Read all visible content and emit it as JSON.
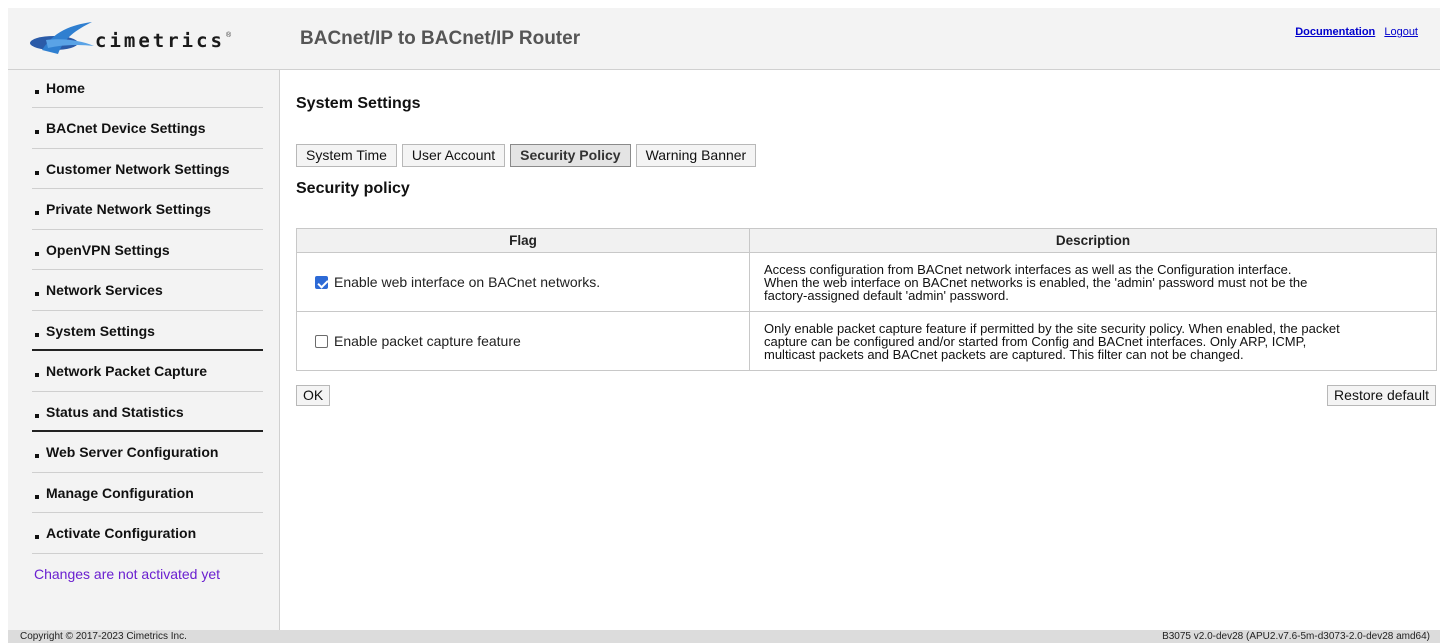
{
  "header": {
    "logo_text": "cimetrics",
    "logo_tm": "®",
    "title": "BACnet/IP to BACnet/IP Router",
    "links": {
      "documentation": "Documentation",
      "logout": "Logout"
    }
  },
  "sidebar": {
    "items": [
      {
        "label": "Home"
      },
      {
        "label": "BACnet Device Settings"
      },
      {
        "label": "Customer Network Settings"
      },
      {
        "label": "Private Network Settings"
      },
      {
        "label": "OpenVPN Settings"
      },
      {
        "label": "Network Services"
      },
      {
        "label": "System Settings"
      },
      {
        "label": "Network Packet Capture"
      },
      {
        "label": "Status and Statistics"
      },
      {
        "label": "Web Server Configuration"
      },
      {
        "label": "Manage Configuration"
      },
      {
        "label": "Activate Configuration"
      }
    ],
    "note": "Changes are not activated yet"
  },
  "main": {
    "title": "System Settings",
    "tabs": [
      {
        "label": "System Time",
        "active": false
      },
      {
        "label": "User Account",
        "active": false
      },
      {
        "label": "Security Policy",
        "active": true
      },
      {
        "label": "Warning Banner",
        "active": false
      }
    ],
    "subtitle": "Security policy",
    "table": {
      "headers": {
        "flag": "Flag",
        "description": "Description"
      },
      "rows": [
        {
          "checked": true,
          "flag": "Enable web interface on BACnet networks.",
          "description_lines": [
            "Access configuration from BACnet network interfaces as well as the Configuration interface.",
            "When the web interface on BACnet networks is enabled, the 'admin' password must not be the",
            "factory-assigned default 'admin' password."
          ]
        },
        {
          "checked": false,
          "flag": "Enable packet capture feature",
          "description_lines": [
            "Only enable packet capture feature if permitted by the site security policy. When enabled, the packet",
            "capture can be configured and/or started from Config and BACnet interfaces. Only ARP, ICMP,",
            "multicast packets and BACnet packets are captured. This filter can not be changed."
          ]
        }
      ]
    },
    "buttons": {
      "ok": "OK",
      "restore": "Restore default"
    }
  },
  "footer": {
    "copyright": "Copyright © 2017-2023 Cimetrics Inc.",
    "version": "B3075 v2.0-dev28 (APU2.v7.6-5m-d3073-2.0-dev28 amd64)"
  },
  "colors": {
    "header_bg": "#f3f3f3",
    "sidebar_note": "#6a1fd0",
    "link": "#0000cc",
    "checkbox_on": "#2d6ad6"
  }
}
